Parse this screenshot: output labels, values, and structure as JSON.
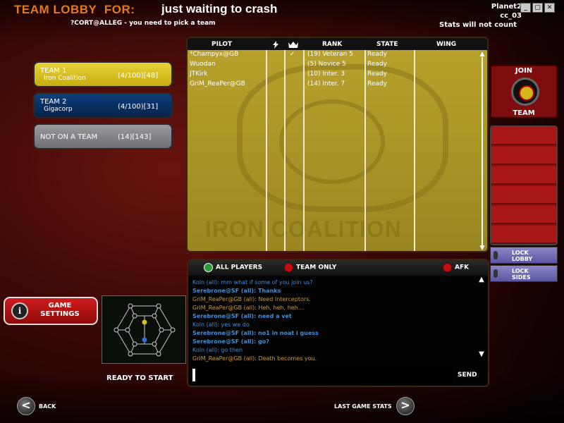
{
  "header": {
    "title": "TEAM LOBBY",
    "for_label": "FOR:",
    "game_name": "just waiting to crash",
    "subtitle": "?CORT@ALLEG - you need to pick a team",
    "server_name": "Planet2",
    "server_code": "cc_03",
    "stats_note": "Stats will not count"
  },
  "window_controls": {
    "minimize": "_",
    "restore": "▢",
    "close": "✕"
  },
  "teams": [
    {
      "name": "TEAM 1",
      "faction": "Iron Coalition",
      "count": "(4/100)[48]",
      "color": "#d7c22a"
    },
    {
      "name": "TEAM 2",
      "faction": "Gigacorp",
      "count": "(4/100)[31]",
      "color": "#0b3567"
    },
    {
      "name": "NOT ON A TEAM",
      "faction": "",
      "count": "(14)[143]",
      "color": "#8a8a8f"
    }
  ],
  "roster": {
    "columns": {
      "pilot": "PILOT",
      "lightning_icon": "lightning-icon",
      "crown_icon": "crown-icon",
      "rank": "RANK",
      "state": "STATE",
      "wing": "WING"
    },
    "watermark": "IRON COALITION",
    "rows": [
      {
        "pilot": "*Champyx@GB",
        "check": "✓",
        "rank": "(19) Veteran 5",
        "state": "Ready",
        "wing": ""
      },
      {
        "pilot": "Wuodan",
        "check": "",
        "rank": "(5) Novice 5",
        "state": "Ready",
        "wing": ""
      },
      {
        "pilot": "JTKirk",
        "check": "",
        "rank": "(10) Inter. 3",
        "state": "Ready",
        "wing": ""
      },
      {
        "pilot": "GriM_ReaPer@GB",
        "check": "",
        "rank": "(14) Inter. 7",
        "state": "Ready",
        "wing": ""
      }
    ]
  },
  "side": {
    "join": "JOIN",
    "team": "TEAM",
    "lock_lobby": [
      "LOCK",
      "LOBBY"
    ],
    "lock_sides": [
      "LOCK",
      "SIDES"
    ]
  },
  "chat": {
    "tab_all": "ALL PLAYERS",
    "tab_team": "TEAM ONLY",
    "tab_afk": "AFK",
    "send": "SEND",
    "messages": [
      {
        "text": "Koln (all): mm what if some of you join us?",
        "style": "blue"
      },
      {
        "text": "Serebrone@SF (all): Thanks",
        "style": "bold"
      },
      {
        "text": "GriM_ReaPer@GB (all): Need Interceptors.",
        "style": "gold"
      },
      {
        "text": "GriM_ReaPer@GB (all): Heh, heh, heh...",
        "style": "gold"
      },
      {
        "text": "Serebrone@SF (all): need a vet",
        "style": "bold"
      },
      {
        "text": "Koln (all): yes we do",
        "style": "blue"
      },
      {
        "text": "Serebrone@SF (all): no1 in noat i guess",
        "style": "bold"
      },
      {
        "text": "Serebrone@SF (all): go?",
        "style": "bold"
      },
      {
        "text": "Koln (all): go then",
        "style": "blue"
      },
      {
        "text": "GriM_ReaPer@GB (all): Death becomes you.",
        "style": "gold"
      }
    ]
  },
  "footer": {
    "game_settings": [
      "GAME",
      "SETTINGS"
    ],
    "ready": "READY TO START",
    "back": "BACK",
    "last_game_stats": "LAST GAME STATS"
  }
}
